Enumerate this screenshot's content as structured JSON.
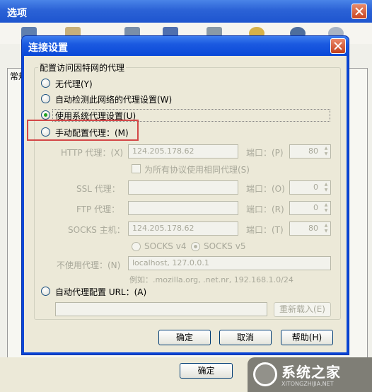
{
  "outer_window": {
    "title": "选项",
    "tab_label": "常规",
    "ok_label": "确定"
  },
  "dialog": {
    "title": "连接设置",
    "group_label": "配置访问因特网的代理",
    "options": {
      "no_proxy": "无代理(Y)",
      "auto_detect": "自动检测此网络的代理设置(W)",
      "system_proxy": "使用系统代理设置(U)",
      "manual_proxy": "手动配置代理：(M)",
      "auto_url": "自动代理配置 URL：(A)"
    },
    "selected_option": "system_proxy",
    "manual": {
      "http_label": "HTTP 代理：(X)",
      "http_value": "124.205.178.62",
      "http_port_label": "端口：(P)",
      "http_port": "80",
      "same_proxy_label": "为所有协议使用相同代理(S)",
      "ssl_label": "SSL 代理：",
      "ssl_port_label": "端口：(O)",
      "ssl_port": "0",
      "ftp_label": "FTP 代理：",
      "ftp_port_label": "端口：(R)",
      "ftp_port": "0",
      "socks_label": "SOCKS 主机：",
      "socks_value": "124.205.178.62",
      "socks_port_label": "端口：(T)",
      "socks_port": "80",
      "socks_v4": "SOCKS v4",
      "socks_v5": "SOCKS v5",
      "no_proxy_label": "不使用代理：(N)",
      "no_proxy_value": "localhost, 127.0.0.1",
      "example": "例如：.mozilla.org, .net.nr, 192.168.1.0/24"
    },
    "reload_label": "重新载入(E)",
    "buttons": {
      "ok": "确定",
      "cancel": "取消",
      "help": "帮助(H)"
    }
  },
  "watermark": {
    "name": "系统之家",
    "url": "XITONGZHIJIA.NET"
  },
  "colors": {
    "titlebar": "#0a46d6",
    "highlight_box": "#d34747",
    "selected_dot": "#21a121"
  }
}
